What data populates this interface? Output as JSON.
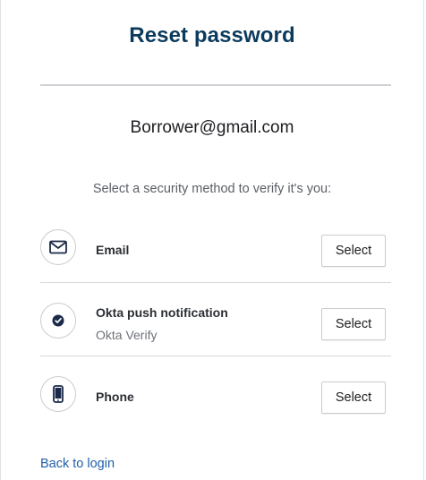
{
  "header": {
    "title": "Reset password"
  },
  "identifier": "Borrower@gmail.com",
  "instructions": "Select a security method to verify it's you:",
  "methods": [
    {
      "label": "Email",
      "subtitle": "",
      "icon": "envelope-icon",
      "button_label": "Select"
    },
    {
      "label": "Okta push notification",
      "subtitle": "Okta Verify",
      "icon": "okta-verify-icon",
      "button_label": "Select"
    },
    {
      "label": "Phone",
      "subtitle": "",
      "icon": "phone-icon",
      "button_label": "Select"
    }
  ],
  "footer": {
    "back_link": "Back to login"
  },
  "colors": {
    "title": "#0b3a5c",
    "link": "#1f5fa8",
    "icon": "#1b2a4a",
    "divider": "#cfd2d6"
  }
}
